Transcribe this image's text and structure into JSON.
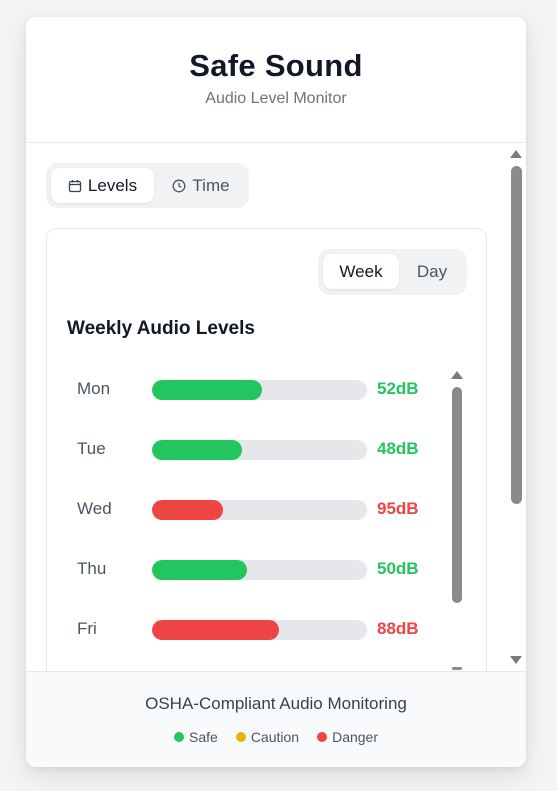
{
  "app": {
    "title": "Safe Sound",
    "subtitle": "Audio Level Monitor"
  },
  "tabs": [
    {
      "label": "Levels",
      "icon": "calendar-icon",
      "active": true
    },
    {
      "label": "Time",
      "icon": "clock-icon",
      "active": false
    }
  ],
  "range_toggle": [
    {
      "label": "Week",
      "active": true
    },
    {
      "label": "Day",
      "active": false
    }
  ],
  "panel": {
    "title": "Weekly Audio Levels"
  },
  "levels": [
    {
      "day": "Mon",
      "value": "52dB",
      "fill_fraction": 0.51,
      "status": "safe"
    },
    {
      "day": "Tue",
      "value": "48dB",
      "fill_fraction": 0.42,
      "status": "safe"
    },
    {
      "day": "Wed",
      "value": "95dB",
      "fill_fraction": 0.33,
      "status": "danger"
    },
    {
      "day": "Thu",
      "value": "50dB",
      "fill_fraction": 0.44,
      "status": "safe"
    },
    {
      "day": "Fri",
      "value": "88dB",
      "fill_fraction": 0.59,
      "status": "danger"
    }
  ],
  "footer": {
    "title": "OSHA-Compliant Audio Monitoring",
    "legend": [
      {
        "label": "Safe",
        "color": "#22c55e"
      },
      {
        "label": "Caution",
        "color": "#eab308"
      },
      {
        "label": "Danger",
        "color": "#ef4444"
      }
    ]
  },
  "colors": {
    "safe": "#22c55e",
    "caution": "#eab308",
    "danger": "#ef4444"
  }
}
